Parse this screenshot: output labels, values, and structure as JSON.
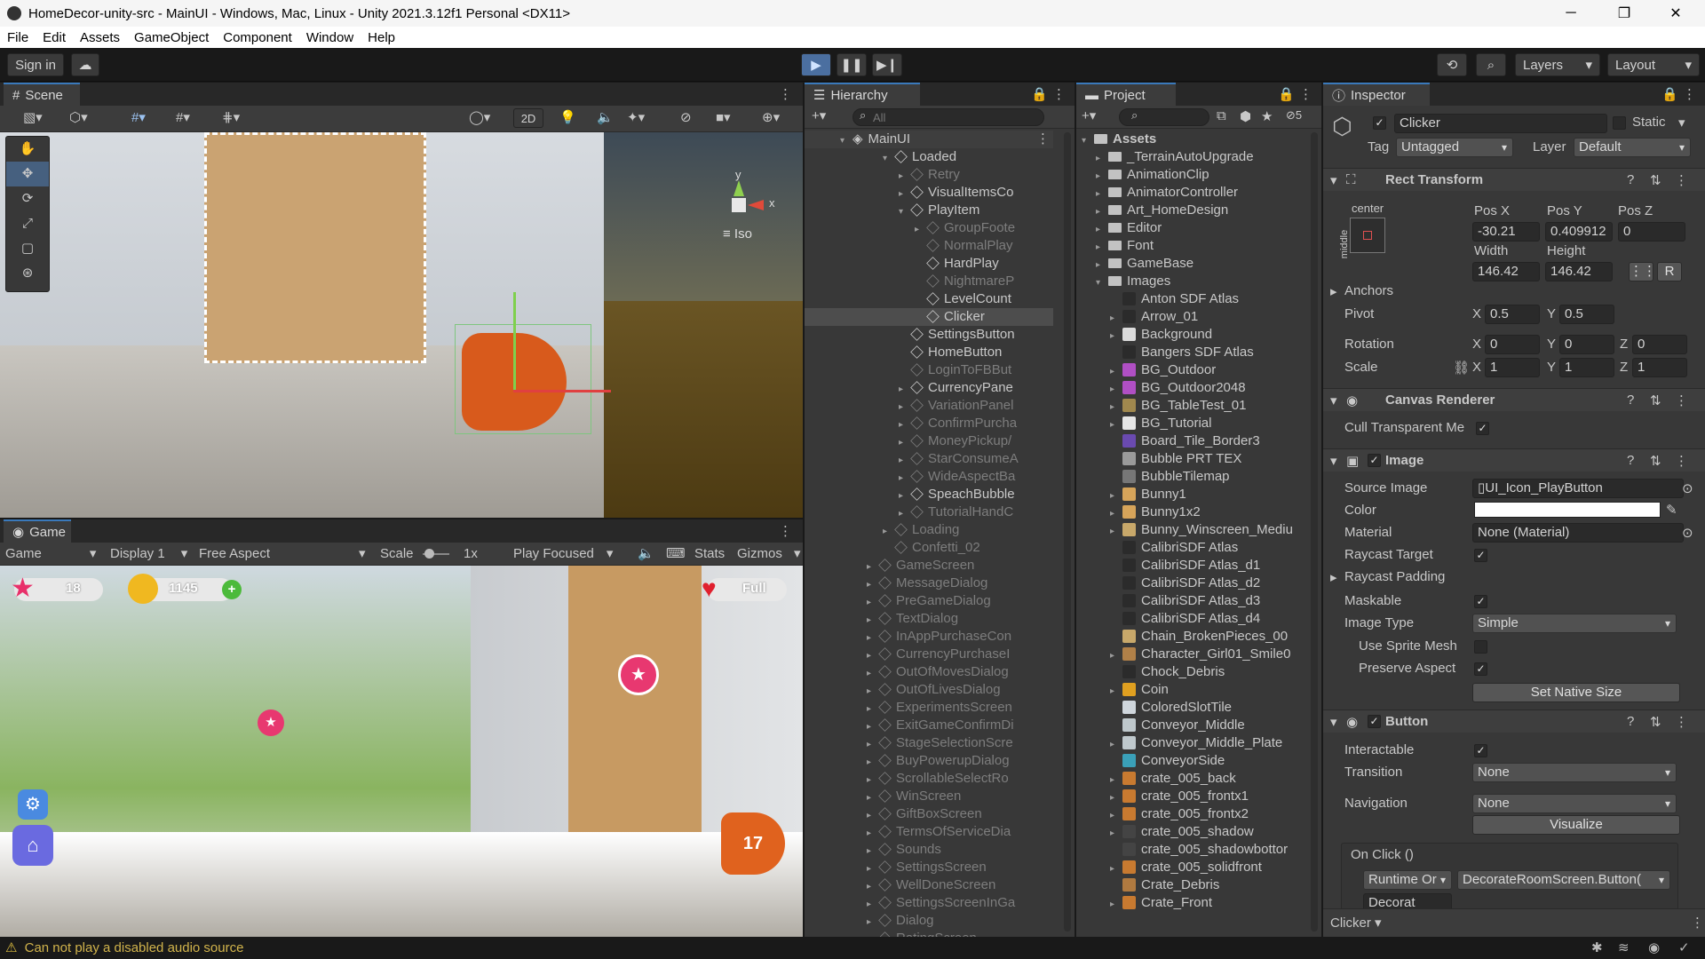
{
  "window": {
    "title": "HomeDecor-unity-src - MainUI - Windows, Mac, Linux - Unity 2021.3.12f1 Personal <DX11>"
  },
  "menu": [
    "File",
    "Edit",
    "Assets",
    "GameObject",
    "Component",
    "Window",
    "Help"
  ],
  "toolbar": {
    "sign_in": "Sign in",
    "layers": "Layers",
    "layout": "Layout"
  },
  "scene": {
    "tab": "Scene",
    "btn_2d": "2D",
    "iso": "Iso",
    "axis_y": "y",
    "axis_x": "x"
  },
  "game": {
    "tab": "Game",
    "mode": "Game",
    "display": "Display 1",
    "aspect": "Free Aspect",
    "scale_label": "Scale",
    "scale_value": "1x",
    "play_focused": "Play Focused",
    "stats": "Stats",
    "gizmos": "Gizmos",
    "hud": {
      "stars": "18",
      "coins": "1145",
      "lives": "Full",
      "level": "17"
    }
  },
  "hierarchy": {
    "tab": "Hierarchy",
    "search_placeholder": "All",
    "root": "MainUI",
    "items": [
      {
        "label": "Loaded",
        "indent": 1,
        "arrow": "▾",
        "dim": false
      },
      {
        "label": "Retry",
        "indent": 2,
        "arrow": "▸",
        "dim": true
      },
      {
        "label": "VisualItemsCo",
        "indent": 2,
        "arrow": "▸",
        "dim": false
      },
      {
        "label": "PlayItem",
        "indent": 2,
        "arrow": "▾",
        "dim": false
      },
      {
        "label": "GroupFoote",
        "indent": 3,
        "arrow": "▸",
        "dim": true
      },
      {
        "label": "NormalPlay",
        "indent": 3,
        "arrow": "",
        "dim": true
      },
      {
        "label": "HardPlay",
        "indent": 3,
        "arrow": "",
        "dim": false
      },
      {
        "label": "NightmareP",
        "indent": 3,
        "arrow": "",
        "dim": true
      },
      {
        "label": "LevelCount",
        "indent": 3,
        "arrow": "",
        "dim": false
      },
      {
        "label": "Clicker",
        "indent": 3,
        "arrow": "",
        "dim": false,
        "selected": true
      },
      {
        "label": "SettingsButton",
        "indent": 2,
        "arrow": "",
        "dim": false
      },
      {
        "label": "HomeButton",
        "indent": 2,
        "arrow": "",
        "dim": false
      },
      {
        "label": "LoginToFBBut",
        "indent": 2,
        "arrow": "",
        "dim": true
      },
      {
        "label": "CurrencyPane",
        "indent": 2,
        "arrow": "▸",
        "dim": false
      },
      {
        "label": "VariationPanel",
        "indent": 2,
        "arrow": "▸",
        "dim": true
      },
      {
        "label": "ConfirmPurcha",
        "indent": 2,
        "arrow": "▸",
        "dim": true
      },
      {
        "label": "MoneyPickup/",
        "indent": 2,
        "arrow": "▸",
        "dim": true
      },
      {
        "label": "StarConsumeA",
        "indent": 2,
        "arrow": "▸",
        "dim": true
      },
      {
        "label": "WideAspectBa",
        "indent": 2,
        "arrow": "▸",
        "dim": true
      },
      {
        "label": "SpeachBubble",
        "indent": 2,
        "arrow": "▸",
        "dim": false
      },
      {
        "label": "TutorialHandC",
        "indent": 2,
        "arrow": "▸",
        "dim": true
      },
      {
        "label": "Loading",
        "indent": 1,
        "arrow": "▸",
        "dim": true
      },
      {
        "label": "Confetti_02",
        "indent": 1,
        "arrow": "",
        "dim": true
      },
      {
        "label": "GameScreen",
        "indent": 0,
        "arrow": "▸",
        "dim": true
      },
      {
        "label": "MessageDialog",
        "indent": 0,
        "arrow": "▸",
        "dim": true
      },
      {
        "label": "PreGameDialog",
        "indent": 0,
        "arrow": "▸",
        "dim": true
      },
      {
        "label": "TextDialog",
        "indent": 0,
        "arrow": "▸",
        "dim": true
      },
      {
        "label": "InAppPurchaseCon",
        "indent": 0,
        "arrow": "▸",
        "dim": true
      },
      {
        "label": "CurrencyPurchaseI",
        "indent": 0,
        "arrow": "▸",
        "dim": true
      },
      {
        "label": "OutOfMovesDialog",
        "indent": 0,
        "arrow": "▸",
        "dim": true
      },
      {
        "label": "OutOfLivesDialog",
        "indent": 0,
        "arrow": "▸",
        "dim": true
      },
      {
        "label": "ExperimentsScreen",
        "indent": 0,
        "arrow": "▸",
        "dim": true
      },
      {
        "label": "ExitGameConfirmDi",
        "indent": 0,
        "arrow": "▸",
        "dim": true
      },
      {
        "label": "StageSelectionScre",
        "indent": 0,
        "arrow": "▸",
        "dim": true
      },
      {
        "label": "BuyPowerupDialog",
        "indent": 0,
        "arrow": "▸",
        "dim": true
      },
      {
        "label": "ScrollableSelectRo",
        "indent": 0,
        "arrow": "▸",
        "dim": true
      },
      {
        "label": "WinScreen",
        "indent": 0,
        "arrow": "▸",
        "dim": true
      },
      {
        "label": "GiftBoxScreen",
        "indent": 0,
        "arrow": "▸",
        "dim": true
      },
      {
        "label": "TermsOfServiceDia",
        "indent": 0,
        "arrow": "▸",
        "dim": true
      },
      {
        "label": "Sounds",
        "indent": 0,
        "arrow": "▸",
        "dim": true
      },
      {
        "label": "SettingsScreen",
        "indent": 0,
        "arrow": "▸",
        "dim": true
      },
      {
        "label": "WellDoneScreen",
        "indent": 0,
        "arrow": "▸",
        "dim": true
      },
      {
        "label": "SettingsScreenInGa",
        "indent": 0,
        "arrow": "▸",
        "dim": true
      },
      {
        "label": "Dialog",
        "indent": 0,
        "arrow": "▸",
        "dim": true
      },
      {
        "label": "RatingScreen",
        "indent": 0,
        "arrow": "▸",
        "dim": true
      }
    ]
  },
  "project": {
    "tab": "Project",
    "count": "5",
    "root": "Assets",
    "items": [
      {
        "label": "_TerrainAutoUpgrade",
        "indent": 1,
        "kind": "folder",
        "arrow": "▸"
      },
      {
        "label": "AnimationClip",
        "indent": 1,
        "kind": "folder",
        "arrow": "▸"
      },
      {
        "label": "AnimatorController",
        "indent": 1,
        "kind": "folder",
        "arrow": "▸"
      },
      {
        "label": "Art_HomeDesign",
        "indent": 1,
        "kind": "folder",
        "arrow": "▸"
      },
      {
        "label": "Editor",
        "indent": 1,
        "kind": "folder",
        "arrow": "▸"
      },
      {
        "label": "Font",
        "indent": 1,
        "kind": "folder",
        "arrow": "▸"
      },
      {
        "label": "GameBase",
        "indent": 1,
        "kind": "folder",
        "arrow": "▸"
      },
      {
        "label": "Images",
        "indent": 1,
        "kind": "folder",
        "arrow": "▾"
      },
      {
        "label": "Anton SDF Atlas",
        "indent": 2,
        "kind": "#2b2b2b",
        "arrow": ""
      },
      {
        "label": "Arrow_01",
        "indent": 2,
        "kind": "#2b2b2b",
        "arrow": "▸"
      },
      {
        "label": "Background",
        "indent": 2,
        "kind": "#dcdcdc",
        "arrow": "▸"
      },
      {
        "label": "Bangers SDF Atlas",
        "indent": 2,
        "kind": "#2b2b2b",
        "arrow": ""
      },
      {
        "label": "BG_Outdoor",
        "indent": 2,
        "kind": "#b04fc4",
        "arrow": "▸"
      },
      {
        "label": "BG_Outdoor2048",
        "indent": 2,
        "kind": "#b04fc4",
        "arrow": "▸"
      },
      {
        "label": "BG_TableTest_01",
        "indent": 2,
        "kind": "#a0884e",
        "arrow": "▸"
      },
      {
        "label": "BG_Tutorial",
        "indent": 2,
        "kind": "#e6e6e6",
        "arrow": "▸"
      },
      {
        "label": "Board_Tile_Border3",
        "indent": 2,
        "kind": "#6a4ab0",
        "arrow": ""
      },
      {
        "label": "Bubble PRT TEX",
        "indent": 2,
        "kind": "#9a9a9a",
        "arrow": ""
      },
      {
        "label": "BubbleTilemap",
        "indent": 2,
        "kind": "#777777",
        "arrow": ""
      },
      {
        "label": "Bunny1",
        "indent": 2,
        "kind": "#d6a45a",
        "arrow": "▸"
      },
      {
        "label": "Bunny1x2",
        "indent": 2,
        "kind": "#d6a45a",
        "arrow": "▸"
      },
      {
        "label": "Bunny_Winscreen_Mediu",
        "indent": 2,
        "kind": "#c8a86a",
        "arrow": "▸"
      },
      {
        "label": "CalibriSDF Atlas",
        "indent": 2,
        "kind": "#2b2b2b",
        "arrow": ""
      },
      {
        "label": "CalibriSDF Atlas_d1",
        "indent": 2,
        "kind": "#2b2b2b",
        "arrow": ""
      },
      {
        "label": "CalibriSDF Atlas_d2",
        "indent": 2,
        "kind": "#2b2b2b",
        "arrow": ""
      },
      {
        "label": "CalibriSDF Atlas_d3",
        "indent": 2,
        "kind": "#2b2b2b",
        "arrow": ""
      },
      {
        "label": "CalibriSDF Atlas_d4",
        "indent": 2,
        "kind": "#2b2b2b",
        "arrow": ""
      },
      {
        "label": "Chain_BrokenPieces_00",
        "indent": 2,
        "kind": "#c8a86a",
        "arrow": ""
      },
      {
        "label": "Character_Girl01_Smile0",
        "indent": 2,
        "kind": "#b08048",
        "arrow": "▸"
      },
      {
        "label": "Chock_Debris",
        "indent": 2,
        "kind": "#2b2b2b",
        "arrow": ""
      },
      {
        "label": "Coin",
        "indent": 2,
        "kind": "#e0a020",
        "arrow": "▸"
      },
      {
        "label": "ColoredSlotTile",
        "indent": 2,
        "kind": "#cfd6dc",
        "arrow": ""
      },
      {
        "label": "Conveyor_Middle",
        "indent": 2,
        "kind": "#bfc8cc",
        "arrow": ""
      },
      {
        "label": "Conveyor_Middle_Plate",
        "indent": 2,
        "kind": "#bfc8cc",
        "arrow": "▸"
      },
      {
        "label": "ConveyorSide",
        "indent": 2,
        "kind": "#3aa0b8",
        "arrow": ""
      },
      {
        "label": "crate_005_back",
        "indent": 2,
        "kind": "#c87a30",
        "arrow": "▸"
      },
      {
        "label": "crate_005_frontx1",
        "indent": 2,
        "kind": "#c87a30",
        "arrow": "▸"
      },
      {
        "label": "crate_005_frontx2",
        "indent": 2,
        "kind": "#c87a30",
        "arrow": "▸"
      },
      {
        "label": "crate_005_shadow",
        "indent": 2,
        "kind": "#444444",
        "arrow": "▸"
      },
      {
        "label": "crate_005_shadowbottor",
        "indent": 2,
        "kind": "#444444",
        "arrow": ""
      },
      {
        "label": "crate_005_solidfront",
        "indent": 2,
        "kind": "#c87a30",
        "arrow": "▸"
      },
      {
        "label": "Crate_Debris",
        "indent": 2,
        "kind": "#b07a40",
        "arrow": ""
      },
      {
        "label": "Crate_Front",
        "indent": 2,
        "kind": "#c87a30",
        "arrow": "▸"
      }
    ]
  },
  "inspector": {
    "tab": "Inspector",
    "object_name": "Clicker",
    "static": "Static",
    "tag_label": "Tag",
    "tag": "Untagged",
    "layer_label": "Layer",
    "layer": "Default",
    "rect": {
      "title": "Rect Transform",
      "anchor": "center",
      "anchor_v": "middle",
      "posx_label": "Pos X",
      "posy_label": "Pos Y",
      "posz_label": "Pos Z",
      "posx": "-30.21",
      "posy": "0.409912",
      "posz": "0",
      "width_label": "Width",
      "height_label": "Height",
      "width": "146.42",
      "height": "146.42",
      "anchors": "Anchors",
      "pivot": "Pivot",
      "pivot_x": "0.5",
      "pivot_y": "0.5",
      "rotation": "Rotation",
      "rot_x": "0",
      "rot_y": "0",
      "rot_z": "0",
      "scale": "Scale",
      "scale_x": "1",
      "scale_y": "1",
      "scale_z": "1",
      "x": "X",
      "y": "Y",
      "z": "Z",
      "r": "R"
    },
    "canvas_renderer": {
      "title": "Canvas Renderer",
      "cull": "Cull Transparent Me"
    },
    "image": {
      "title": "Image",
      "source_label": "Source Image",
      "source": "UI_Icon_PlayButton",
      "color_label": "Color",
      "material_label": "Material",
      "material": "None (Material)",
      "raycast_target": "Raycast Target",
      "raycast_padding": "Raycast Padding",
      "maskable": "Maskable",
      "image_type_label": "Image Type",
      "image_type": "Simple",
      "use_sprite_mesh": "Use Sprite Mesh",
      "preserve_aspect": "Preserve Aspect",
      "set_native_size": "Set Native Size"
    },
    "button": {
      "title": "Button",
      "interactable": "Interactable",
      "transition_label": "Transition",
      "transition": "None",
      "navigation_label": "Navigation",
      "navigation": "None",
      "visualize": "Visualize",
      "on_click": "On Click ()",
      "runtime": "Runtime Or",
      "function": "DecorateRoomScreen.Button(",
      "object": "Decorat"
    },
    "footer": "Clicker"
  },
  "status": {
    "message": "Can not play a disabled audio source"
  }
}
